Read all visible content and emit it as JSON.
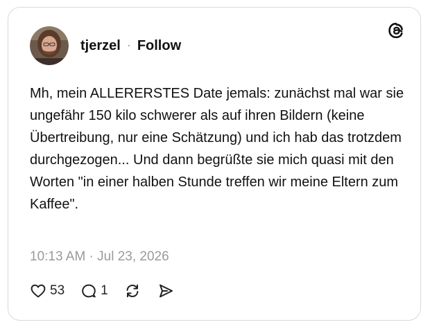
{
  "post": {
    "username": "tjerzel",
    "separator": "·",
    "follow_label": "Follow",
    "text": "Mh, mein ALLERERSTES Date jemals: zunächst mal war sie ungefähr 150 kilo schwerer als auf ihren Bildern (keine Übertreibung, nur eine Schätzung) und ich hab das trotzdem durchgezogen... Und dann begrüßte sie mich quasi mit den Worten \"in einer halben Stunde treffen wir meine Eltern zum Kaffee\".",
    "timestamp": "10:13 AM · Jul 23, 2026"
  },
  "actions": {
    "likes": "53",
    "replies": "1"
  },
  "icons": {
    "logo": "threads-logo-icon",
    "like": "heart-icon",
    "reply": "comment-icon",
    "repost": "repost-icon",
    "share": "send-icon"
  },
  "colors": {
    "text": "#111111",
    "muted": "#9a9a9a",
    "border": "#d9d9d9"
  }
}
